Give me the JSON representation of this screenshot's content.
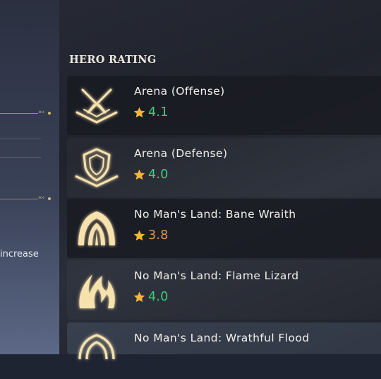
{
  "left_panel": {
    "increase_text": "increase"
  },
  "section": {
    "title": "HERO RATING"
  },
  "ratings": [
    {
      "title": "Arena (Offense)",
      "value": "4.1",
      "color": "#37d27a",
      "icon": "crossed-swords-icon"
    },
    {
      "title": "Arena (Defense)",
      "value": "4.0",
      "color": "#37d27a",
      "icon": "shield-icon"
    },
    {
      "title": "No Man's Land: Bane Wraith",
      "value": "3.8",
      "color": "#e49552",
      "icon": "wraith-icon"
    },
    {
      "title": "No Man's Land: Flame Lizard",
      "value": "4.0",
      "color": "#37d27a",
      "icon": "flame-icon"
    },
    {
      "title": "No Man's Land: Wrathful Flood",
      "value": "",
      "color": "#37d27a",
      "icon": "flood-icon"
    }
  ],
  "colors": {
    "star": "#f3b53c",
    "icon_gold": "#f7e2ae",
    "icon_glow": "#c8923e"
  }
}
